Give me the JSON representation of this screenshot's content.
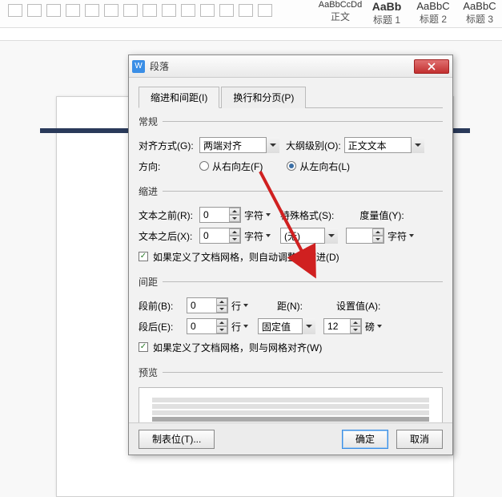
{
  "toolbar": {
    "styles": [
      {
        "sample": "AaBbCcDd",
        "name": "正文"
      },
      {
        "sample": "AaBb",
        "name": "标题 1"
      },
      {
        "sample": "AaBbC",
        "name": "标题 2"
      },
      {
        "sample": "AaBbC",
        "name": "标题 3"
      }
    ]
  },
  "dialog": {
    "title": "段落",
    "tabs": {
      "indent": "缩进和间距(I)",
      "pagebreak": "换行和分页(P)"
    },
    "general": {
      "legend": "常规",
      "align_label": "对齐方式(G):",
      "align_value": "两端对齐",
      "outline_label": "大纲级别(O):",
      "outline_value": "正文文本",
      "direction_label": "方向:",
      "rtl_label": "从右向左(F)",
      "ltr_label": "从左向右(L)"
    },
    "indent": {
      "legend": "缩进",
      "before_label": "文本之前(R):",
      "before_value": "0",
      "before_unit": "字符",
      "after_label": "文本之后(X):",
      "after_value": "0",
      "after_unit": "字符",
      "special_label": "特殊格式(S):",
      "special_value": "(无)",
      "measure_label": "度量值(Y):",
      "measure_value": "",
      "measure_unit": "字符",
      "grid_check": "如果定义了文档网格，则自动调整右缩进(D)"
    },
    "spacing": {
      "legend": "间距",
      "before_label": "段前(B):",
      "before_value": "0",
      "before_unit": "行",
      "after_label": "段后(E):",
      "after_value": "0",
      "after_unit": "行",
      "lineheight_label": "距(N):",
      "lineheight_value": "固定值",
      "setvalue_label": "设置值(A):",
      "setvalue_value": "12",
      "setvalue_unit": "磅",
      "grid_check": "如果定义了文档网格，则与网格对齐(W)"
    },
    "preview_label": "预览",
    "footer": {
      "tabs_btn": "制表位(T)...",
      "ok": "确定",
      "cancel": "取消"
    }
  },
  "colors": {
    "accent": "#3a8ee6",
    "arrow": "#d02020"
  }
}
